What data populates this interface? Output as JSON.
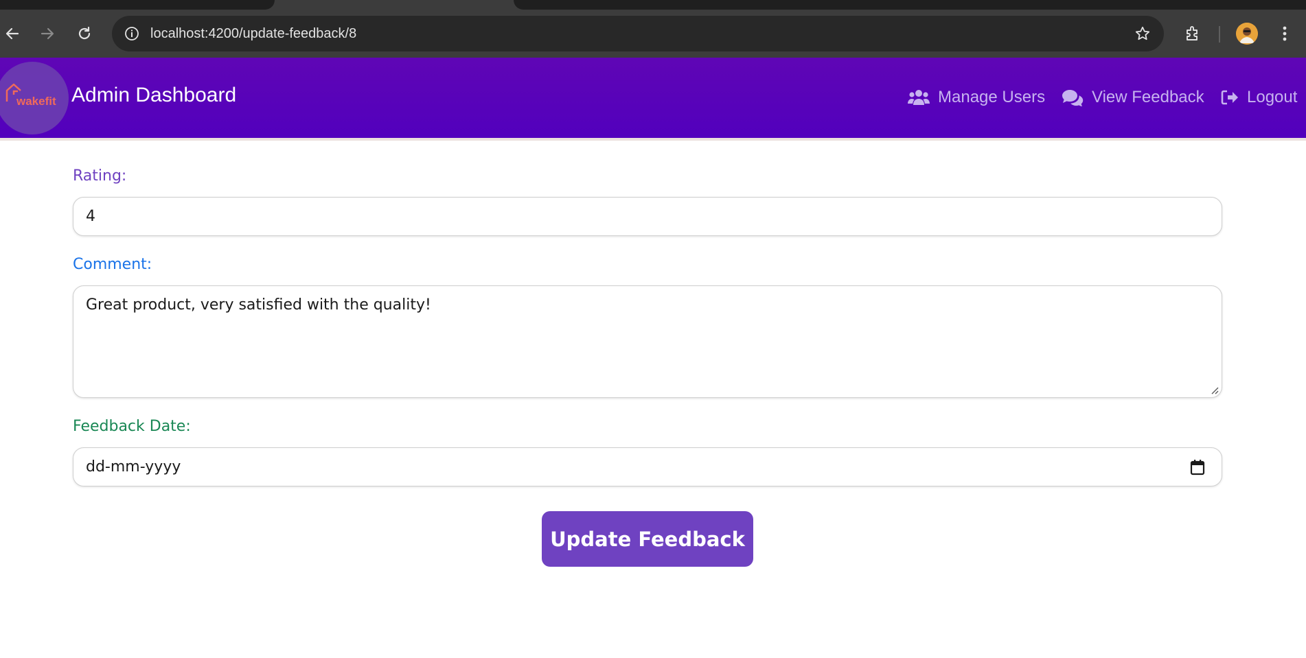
{
  "browser": {
    "url": "localhost:4200/update-feedback/8"
  },
  "header": {
    "logo_text": "wakefit",
    "title": "Admin Dashboard",
    "nav": [
      {
        "label": "Manage Users",
        "icon": "users-icon"
      },
      {
        "label": "View Feedback",
        "icon": "comments-icon"
      },
      {
        "label": "Logout",
        "icon": "logout-icon"
      }
    ],
    "background": "#5a03b8",
    "nav_color": "#c7b3ef"
  },
  "form": {
    "rating_label": "Rating:",
    "rating_value": "4",
    "comment_label": "Comment:",
    "comment_value": "Great product, very satisfied with the quality!",
    "date_label": "Feedback Date:",
    "date_placeholder": "dd-mm-yyyy",
    "submit_label": "Update Feedback",
    "rating_label_color": "#6f42c1",
    "comment_label_color": "#1a73e8",
    "date_label_color": "#198754",
    "submit_color": "#6f42c1"
  }
}
